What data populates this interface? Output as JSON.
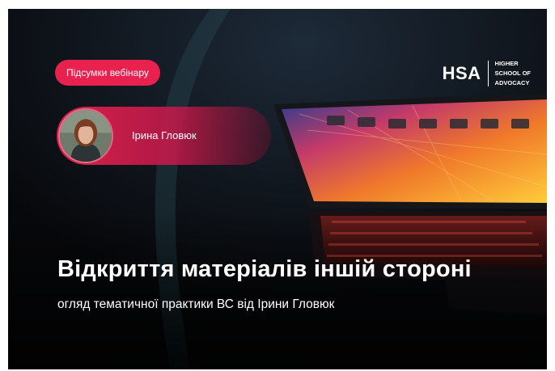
{
  "badge": {
    "label": "Підсумки вебінару"
  },
  "logo": {
    "mark": "HSA",
    "line1": "HIGHER",
    "line2": "SCHOOL OF",
    "line3": "ADVOCACY"
  },
  "speaker": {
    "name": "Ірина Гловюк"
  },
  "title": "Відкриття матеріалів іншій стороні",
  "subtitle": "огляд тематичної практики ВС від Ірини Гловюк",
  "colors": {
    "accent": "#e8214f",
    "background": "#0b0c10"
  }
}
